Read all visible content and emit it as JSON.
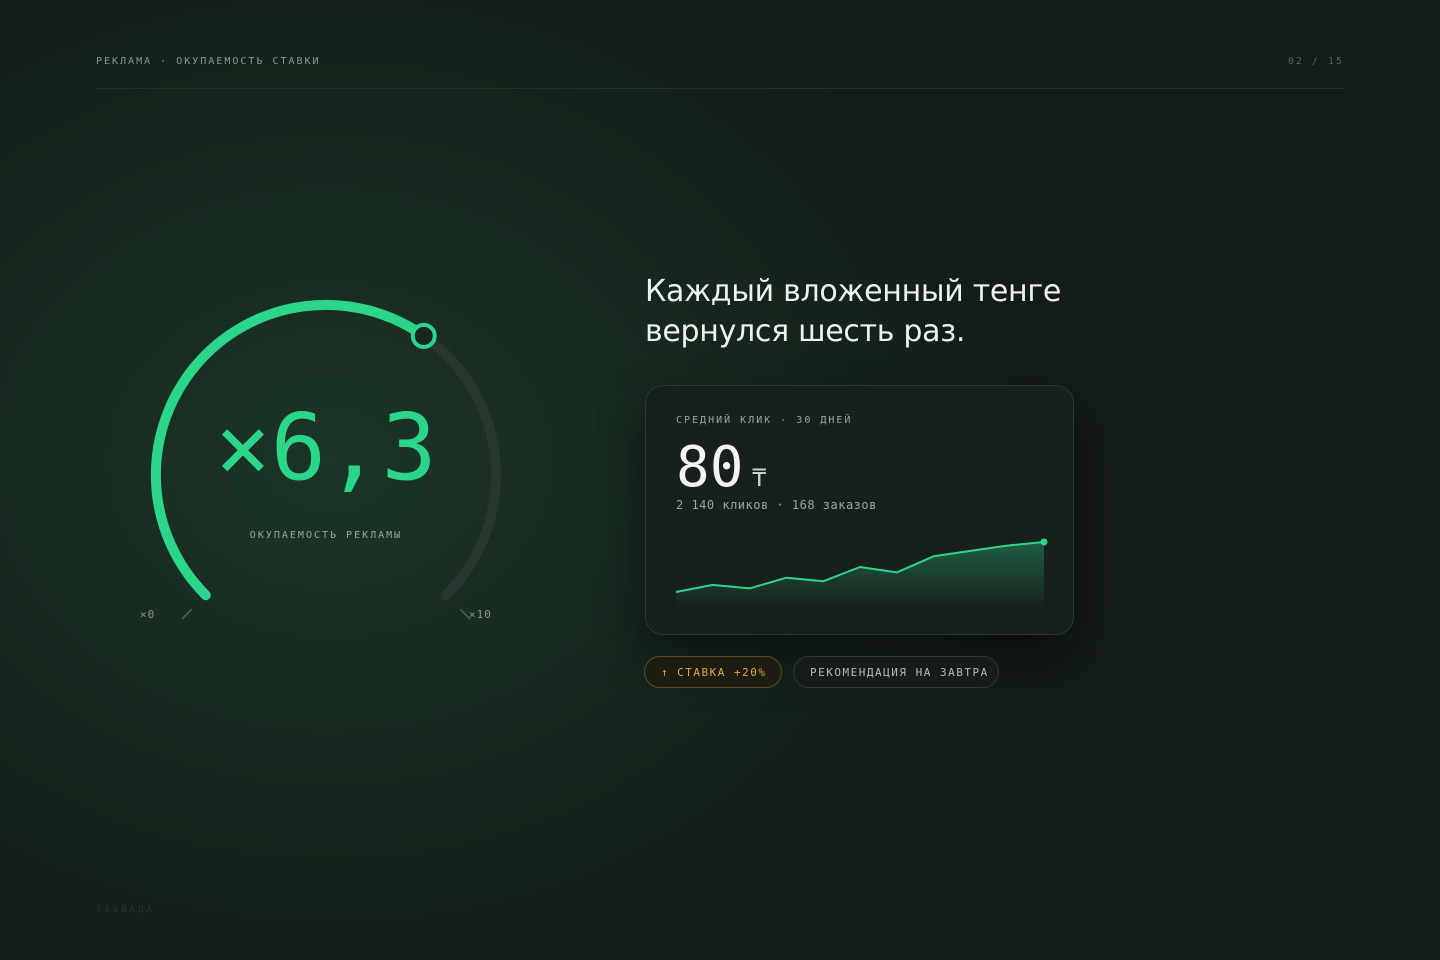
{
  "header": {
    "breadcrumb": "РЕКЛАМА · ОКУПАЕМОСТЬ СТАВКИ",
    "pager": "02 / 15"
  },
  "footer": {
    "brand": "TASBAQA"
  },
  "colors": {
    "accent": "#2bd68a",
    "warning": "#e0a935",
    "background": "#141c18"
  },
  "gauge": {
    "value_text": "×6,3",
    "value": 6.3,
    "min": 0,
    "max": 10,
    "min_label": "×0",
    "max_label": "×10",
    "caption": "ОКУПАЕМОСТЬ РЕКЛАМЫ"
  },
  "headline": {
    "line1": "Каждый вложенный тенге",
    "line2": "вернулся шесть раз."
  },
  "card": {
    "label": "СРЕДНИЙ КЛИК · 30 ДНЕЙ",
    "value": "80",
    "currency": "₸",
    "subtitle": "2 140 кликов · 168 заказов",
    "sparkline": [
      28,
      24,
      26,
      20,
      22,
      14,
      17,
      8,
      5,
      2,
      0
    ]
  },
  "chips": {
    "bid_icon": "arrow-up-icon",
    "bid_arrow": "↑",
    "bid_label": "СТАВКА +20%",
    "recommendation_label": "РЕКОМЕНДАЦИЯ НА ЗАВТРА"
  }
}
